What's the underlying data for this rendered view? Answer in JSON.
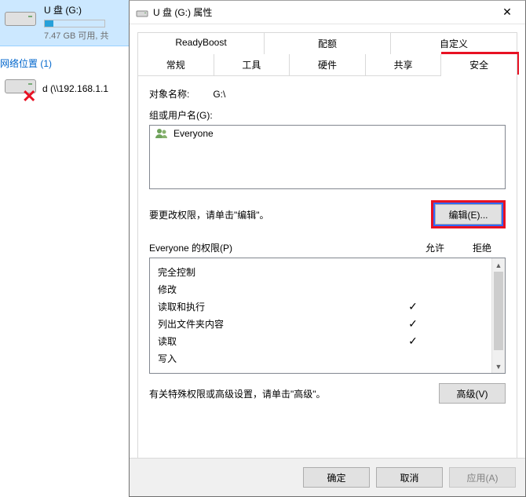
{
  "explorer": {
    "drive_label": "U 盘 (G:)",
    "drive_sub": "7.47 GB 可用, 共",
    "net_header": "网络位置 (1)",
    "net_item": "d (\\\\192.168.1.1"
  },
  "dialog": {
    "title": "U 盘 (G:) 属性",
    "close": "✕",
    "tabs_top": [
      "ReadyBoost",
      "配额",
      "自定义"
    ],
    "tabs_bottom": [
      "常规",
      "工具",
      "硬件",
      "共享",
      "安全"
    ],
    "active_tab": "安全",
    "object_label": "对象名称:",
    "object_value": "G:\\",
    "group_label": "组或用户名(G):",
    "groups": [
      "Everyone"
    ],
    "edit_hint": "要更改权限，请单击\"编辑\"。",
    "edit_button": "编辑(E)...",
    "perm_header": "Everyone 的权限(P)",
    "perm_allow": "允许",
    "perm_deny": "拒绝",
    "permissions": [
      {
        "name": "完全控制",
        "allow": false,
        "deny": false
      },
      {
        "name": "修改",
        "allow": false,
        "deny": false
      },
      {
        "name": "读取和执行",
        "allow": true,
        "deny": false
      },
      {
        "name": "列出文件夹内容",
        "allow": true,
        "deny": false
      },
      {
        "name": "读取",
        "allow": true,
        "deny": false
      },
      {
        "name": "写入",
        "allow": false,
        "deny": false
      }
    ],
    "adv_hint": "有关特殊权限或高级设置，请单击\"高级\"。",
    "adv_button": "高级(V)",
    "ok": "确定",
    "cancel": "取消",
    "apply": "应用(A)"
  }
}
